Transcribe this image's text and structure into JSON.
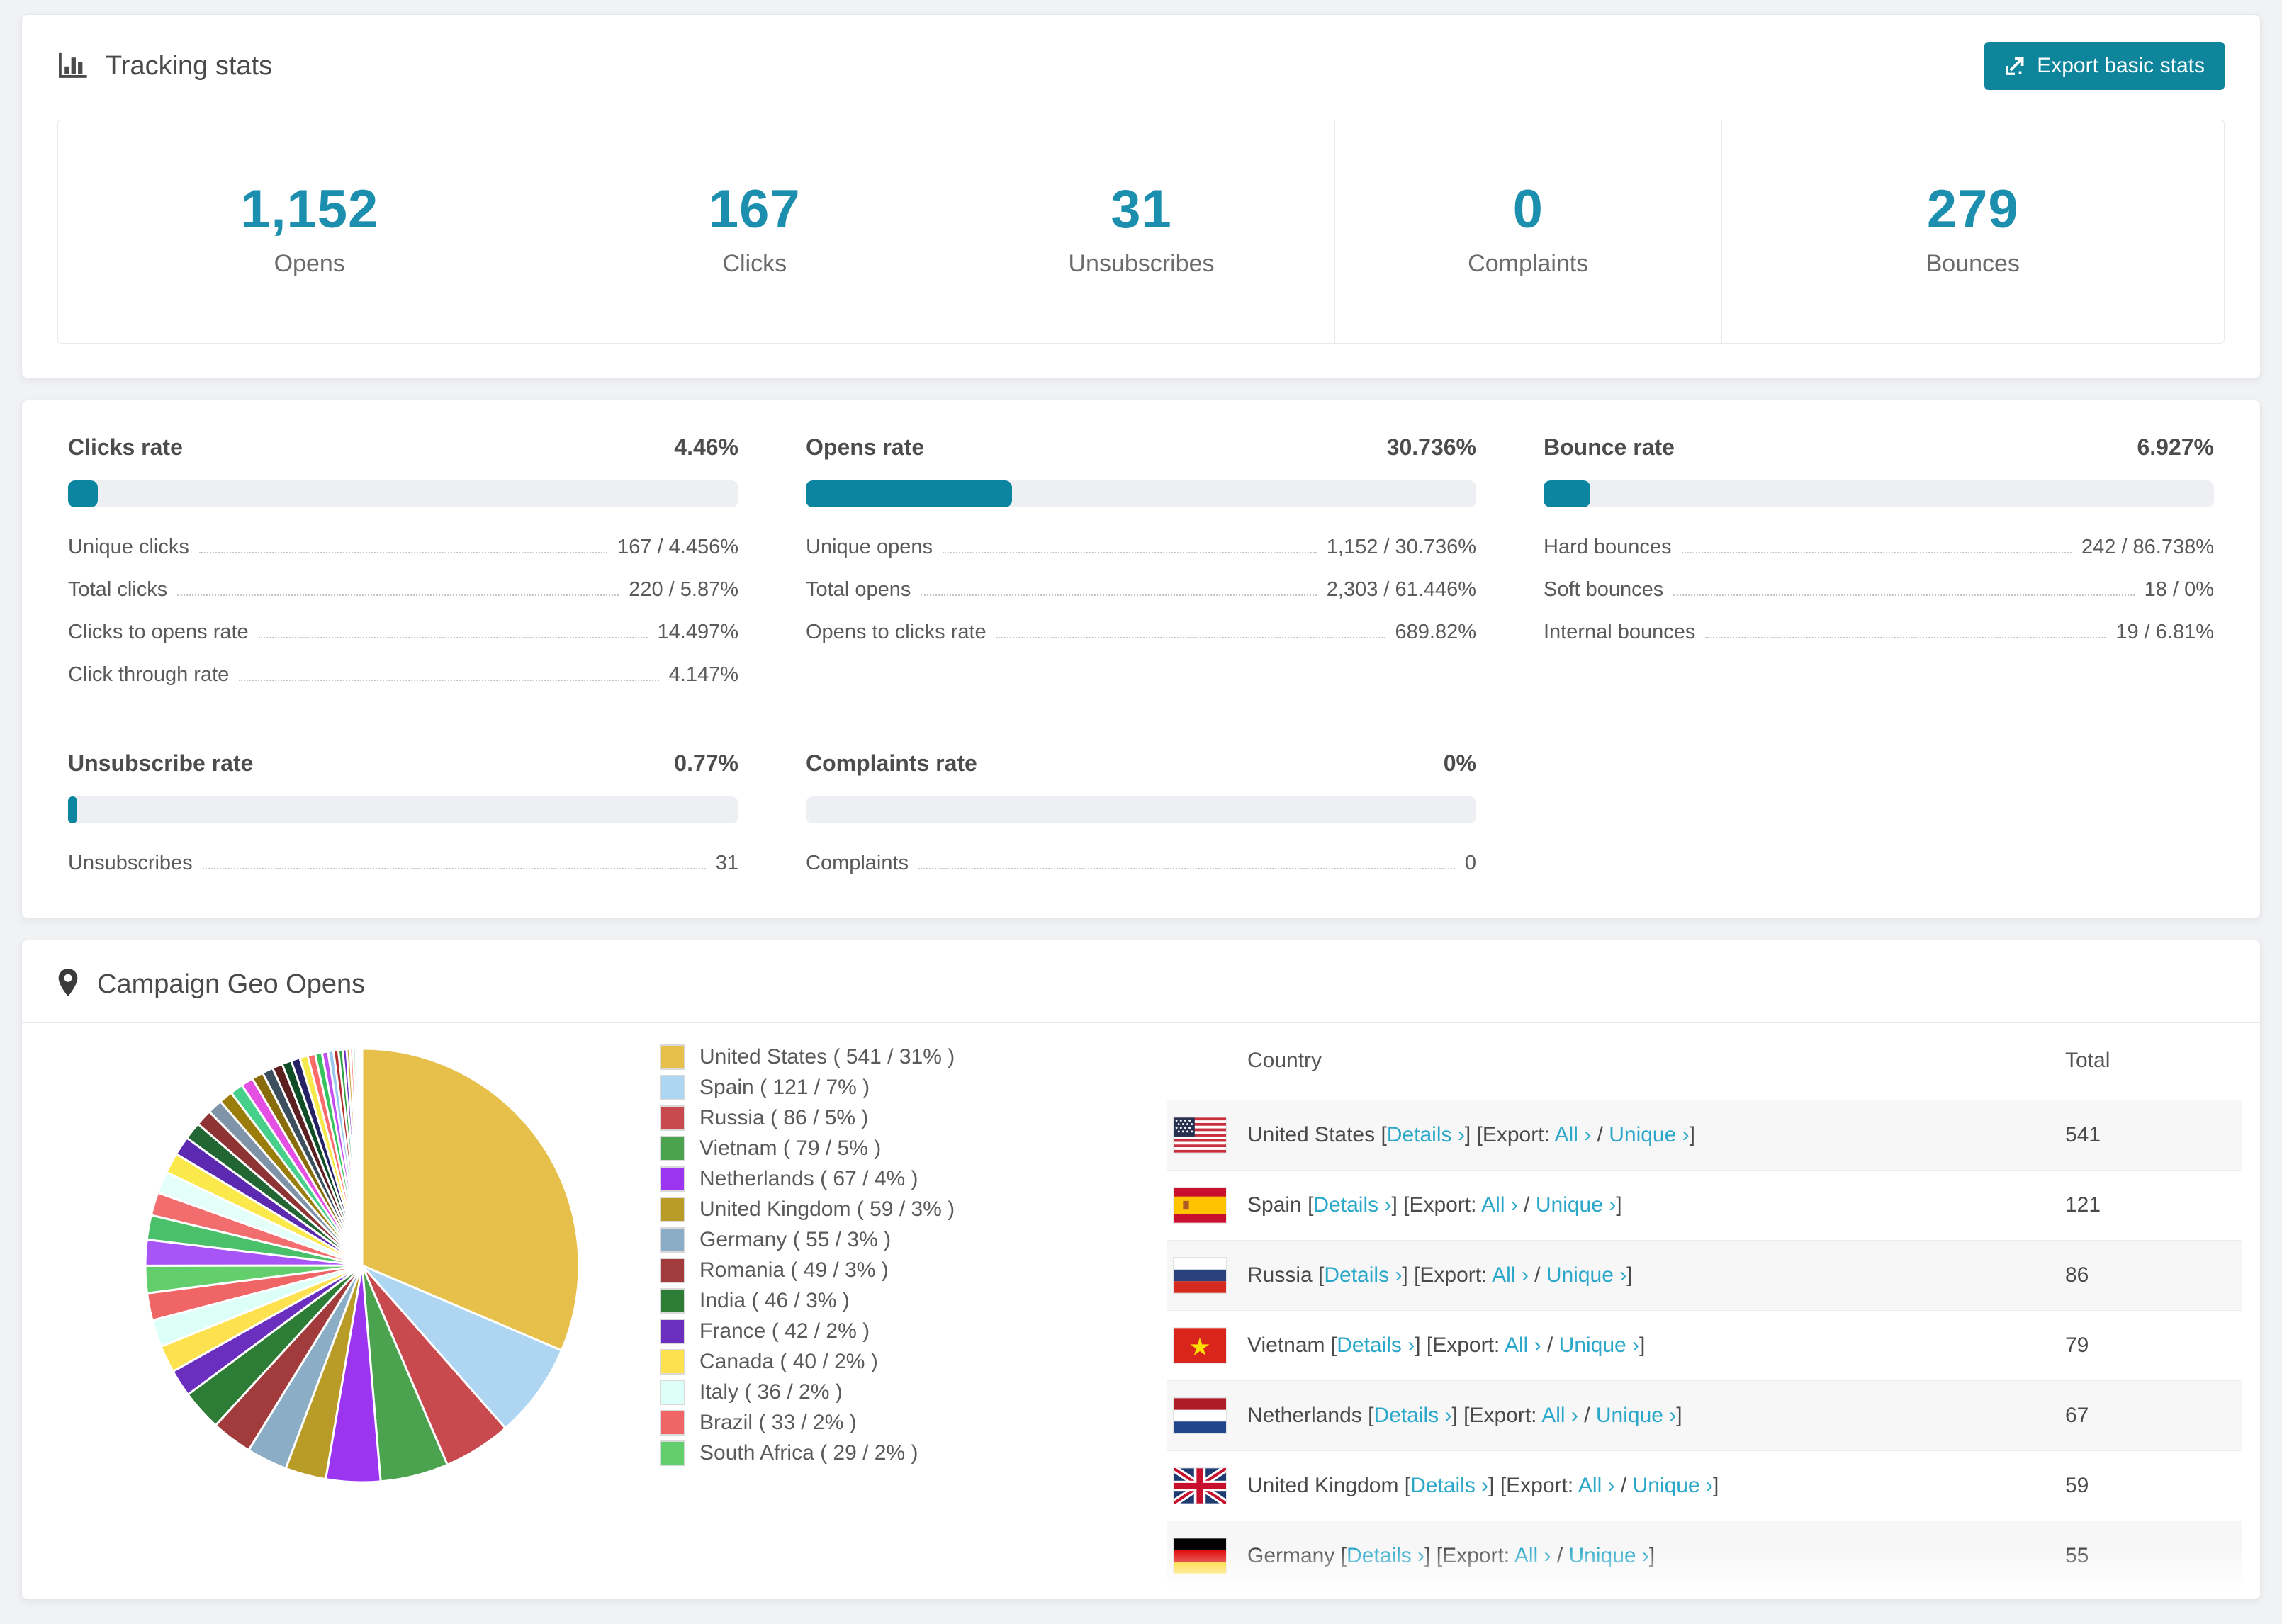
{
  "accent": {
    "number_teal": "#1b8fad",
    "button_teal": "#0f859c",
    "bar_fill_teal": "#0c86a0",
    "link_cyan": "#2ba7c9"
  },
  "header": {
    "title": "Tracking stats",
    "export_label": "Export basic stats"
  },
  "summary_stats": [
    {
      "value": "1,152",
      "label": "Opens"
    },
    {
      "value": "167",
      "label": "Clicks"
    },
    {
      "value": "31",
      "label": "Unsubscribes"
    },
    {
      "value": "0",
      "label": "Complaints"
    },
    {
      "value": "279",
      "label": "Bounces"
    }
  ],
  "rate_blocks": [
    {
      "title": "Clicks rate",
      "value": "4.46%",
      "percent": 4.46,
      "metrics": [
        {
          "label": "Unique clicks",
          "value": "167 / 4.456%"
        },
        {
          "label": "Total clicks",
          "value": "220 / 5.87%"
        },
        {
          "label": "Clicks to opens rate",
          "value": "14.497%"
        },
        {
          "label": "Click through rate",
          "value": "4.147%"
        }
      ]
    },
    {
      "title": "Opens rate",
      "value": "30.736%",
      "percent": 30.736,
      "metrics": [
        {
          "label": "Unique opens",
          "value": "1,152 / 30.736%"
        },
        {
          "label": "Total opens",
          "value": "2,303 / 61.446%"
        },
        {
          "label": "Opens to clicks rate",
          "value": "689.82%"
        }
      ]
    },
    {
      "title": "Bounce rate",
      "value": "6.927%",
      "percent": 6.927,
      "metrics": [
        {
          "label": "Hard bounces",
          "value": "242 / 86.738%"
        },
        {
          "label": "Soft bounces",
          "value": "18 / 0%"
        },
        {
          "label": "Internal bounces",
          "value": "19 / 6.81%"
        }
      ]
    },
    {
      "title": "Unsubscribe rate",
      "value": "0.77%",
      "percent": 0.77,
      "metrics": [
        {
          "label": "Unsubscribes",
          "value": "31"
        }
      ]
    },
    {
      "title": "Complaints rate",
      "value": "0%",
      "percent": 0,
      "metrics": [
        {
          "label": "Complaints",
          "value": "0"
        }
      ]
    }
  ],
  "geo": {
    "title": "Campaign Geo Opens",
    "chart_data": {
      "type": "pie",
      "title": "Campaign Geo Opens",
      "legend_position": "right",
      "series": [
        {
          "name": "United States",
          "count": 541,
          "pct": 31,
          "color": "#e6c04a",
          "flag": "us"
        },
        {
          "name": "Spain",
          "count": 121,
          "pct": 7,
          "color": "#aed6f2",
          "flag": "es"
        },
        {
          "name": "Russia",
          "count": 86,
          "pct": 5,
          "color": "#c94a4e",
          "flag": "ru"
        },
        {
          "name": "Vietnam",
          "count": 79,
          "pct": 5,
          "color": "#4ba350",
          "flag": "vn"
        },
        {
          "name": "Netherlands",
          "count": 67,
          "pct": 4,
          "color": "#9b35f0",
          "flag": "nl"
        },
        {
          "name": "United Kingdom",
          "count": 59,
          "pct": 3,
          "color": "#b99b28",
          "flag": "gb"
        },
        {
          "name": "Germany",
          "count": 55,
          "pct": 3,
          "color": "#8badc5",
          "flag": "de"
        },
        {
          "name": "Romania",
          "count": 49,
          "pct": 3,
          "color": "#a23c3c",
          "flag": ""
        },
        {
          "name": "India",
          "count": 46,
          "pct": 3,
          "color": "#2e7d36",
          "flag": ""
        },
        {
          "name": "France",
          "count": 42,
          "pct": 2,
          "color": "#6b2fc0",
          "flag": ""
        },
        {
          "name": "Canada",
          "count": 40,
          "pct": 2,
          "color": "#fde14e",
          "flag": ""
        },
        {
          "name": "Italy",
          "count": 36,
          "pct": 2,
          "color": "#dcfff7",
          "flag": ""
        },
        {
          "name": "Brazil",
          "count": 33,
          "pct": 2,
          "color": "#f06565",
          "flag": ""
        },
        {
          "name": "South Africa",
          "count": 29,
          "pct": 2,
          "color": "#62ce6c",
          "flag": ""
        }
      ],
      "other_slices": {
        "values": [
          1.9,
          1.8,
          1.7,
          1.6,
          1.5,
          1.4,
          1.3,
          1.2,
          1.1,
          1.0,
          0.95,
          0.9,
          0.85,
          0.8,
          0.75,
          0.7,
          0.65,
          0.6,
          0.55,
          0.5,
          0.45,
          0.4,
          0.36,
          0.32,
          0.28,
          0.25,
          0.22,
          0.19,
          0.16,
          0.13,
          0.1,
          0.08
        ],
        "colors": [
          "#a855f7",
          "#4bc06a",
          "#f26d6d",
          "#e4fffa",
          "#fbe84a",
          "#5b2ab0",
          "#226633",
          "#8e3434",
          "#7f94a8",
          "#9a7d0a",
          "#46d08a",
          "#e44fe4",
          "#8a6d0b",
          "#3c4f5e",
          "#5c2020",
          "#0e4d26",
          "#242264",
          "#f6e94b",
          "#fb6b6b",
          "#37c25e",
          "#c44ff0",
          "#9cc7ef",
          "#b03030",
          "#2f9e44",
          "#7030c0",
          "#c8a236",
          "#ff8080",
          "#8fe3a0",
          "#a8d4f5",
          "#ee66cc",
          "#9a6210",
          "#6d28d9"
        ]
      }
    },
    "legend_format": "%name ( %count / %pct% )",
    "table": {
      "headers": {
        "country": "Country",
        "total": "Total"
      },
      "links": {
        "details": "Details ›",
        "all": "All ›",
        "unique": "Unique ›"
      },
      "syntax": {
        "open": "[",
        "close": "]",
        "export_prefix": "[Export:",
        "slash": "/"
      },
      "rows": [
        {
          "country": "United States",
          "flag": "us",
          "total": "541"
        },
        {
          "country": "Spain",
          "flag": "es",
          "total": "121"
        },
        {
          "country": "Russia",
          "flag": "ru",
          "total": "86"
        },
        {
          "country": "Vietnam",
          "flag": "vn",
          "total": "79"
        },
        {
          "country": "Netherlands",
          "flag": "nl",
          "total": "67"
        },
        {
          "country": "United Kingdom",
          "flag": "gb",
          "total": "59"
        },
        {
          "country": "Germany",
          "flag": "de",
          "total": "55"
        }
      ]
    }
  }
}
